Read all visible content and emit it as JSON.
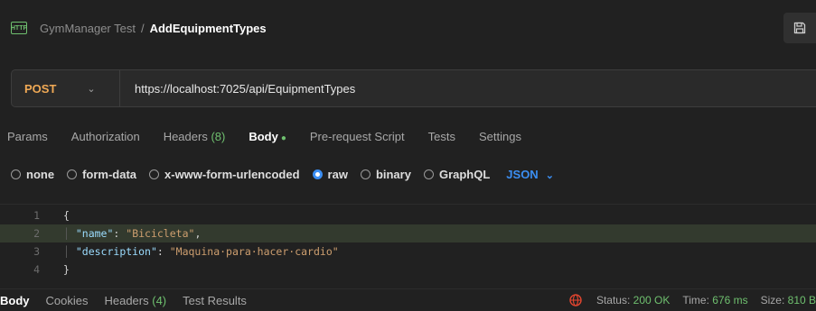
{
  "header": {
    "http_badge": "HTTP",
    "collection": "GymManager Test",
    "separator": "/",
    "request_name": "AddEquipmentTypes"
  },
  "request": {
    "method": "POST",
    "url": "https://localhost:7025/api/EquipmentTypes"
  },
  "tabs": [
    {
      "label": "Params"
    },
    {
      "label": "Authorization"
    },
    {
      "label": "Headers",
      "count": "(8)"
    },
    {
      "label": "Body",
      "active": true
    },
    {
      "label": "Pre-request Script"
    },
    {
      "label": "Tests"
    },
    {
      "label": "Settings"
    }
  ],
  "body_types": {
    "options": [
      "none",
      "form-data",
      "x-www-form-urlencoded",
      "raw",
      "binary",
      "GraphQL"
    ],
    "selected": "raw",
    "format": "JSON"
  },
  "editor": {
    "lines": [
      {
        "n": "1",
        "text": "{"
      },
      {
        "n": "2",
        "key": "\"name\"",
        "colon": ": ",
        "value": "\"Bicicleta\"",
        "end": ","
      },
      {
        "n": "3",
        "key": "\"description\"",
        "colon": ": ",
        "value": "\"Maquina·para·hacer·cardio\"",
        "end": ""
      },
      {
        "n": "4",
        "text": "}"
      }
    ]
  },
  "response": {
    "tabs": [
      "Body",
      "Cookies",
      "Headers",
      "Test Results"
    ],
    "headers_count": "(4)",
    "status_label": "Status:",
    "status_value": "200 OK",
    "time_label": "Time:",
    "time_value": "676 ms",
    "size_label": "Size:",
    "size_value": "810 B"
  },
  "colors": {
    "accent_green": "#6fc06f",
    "method_orange": "#f0a955",
    "accent_blue": "#3b8ef2",
    "globe_red": "#e0452f"
  }
}
